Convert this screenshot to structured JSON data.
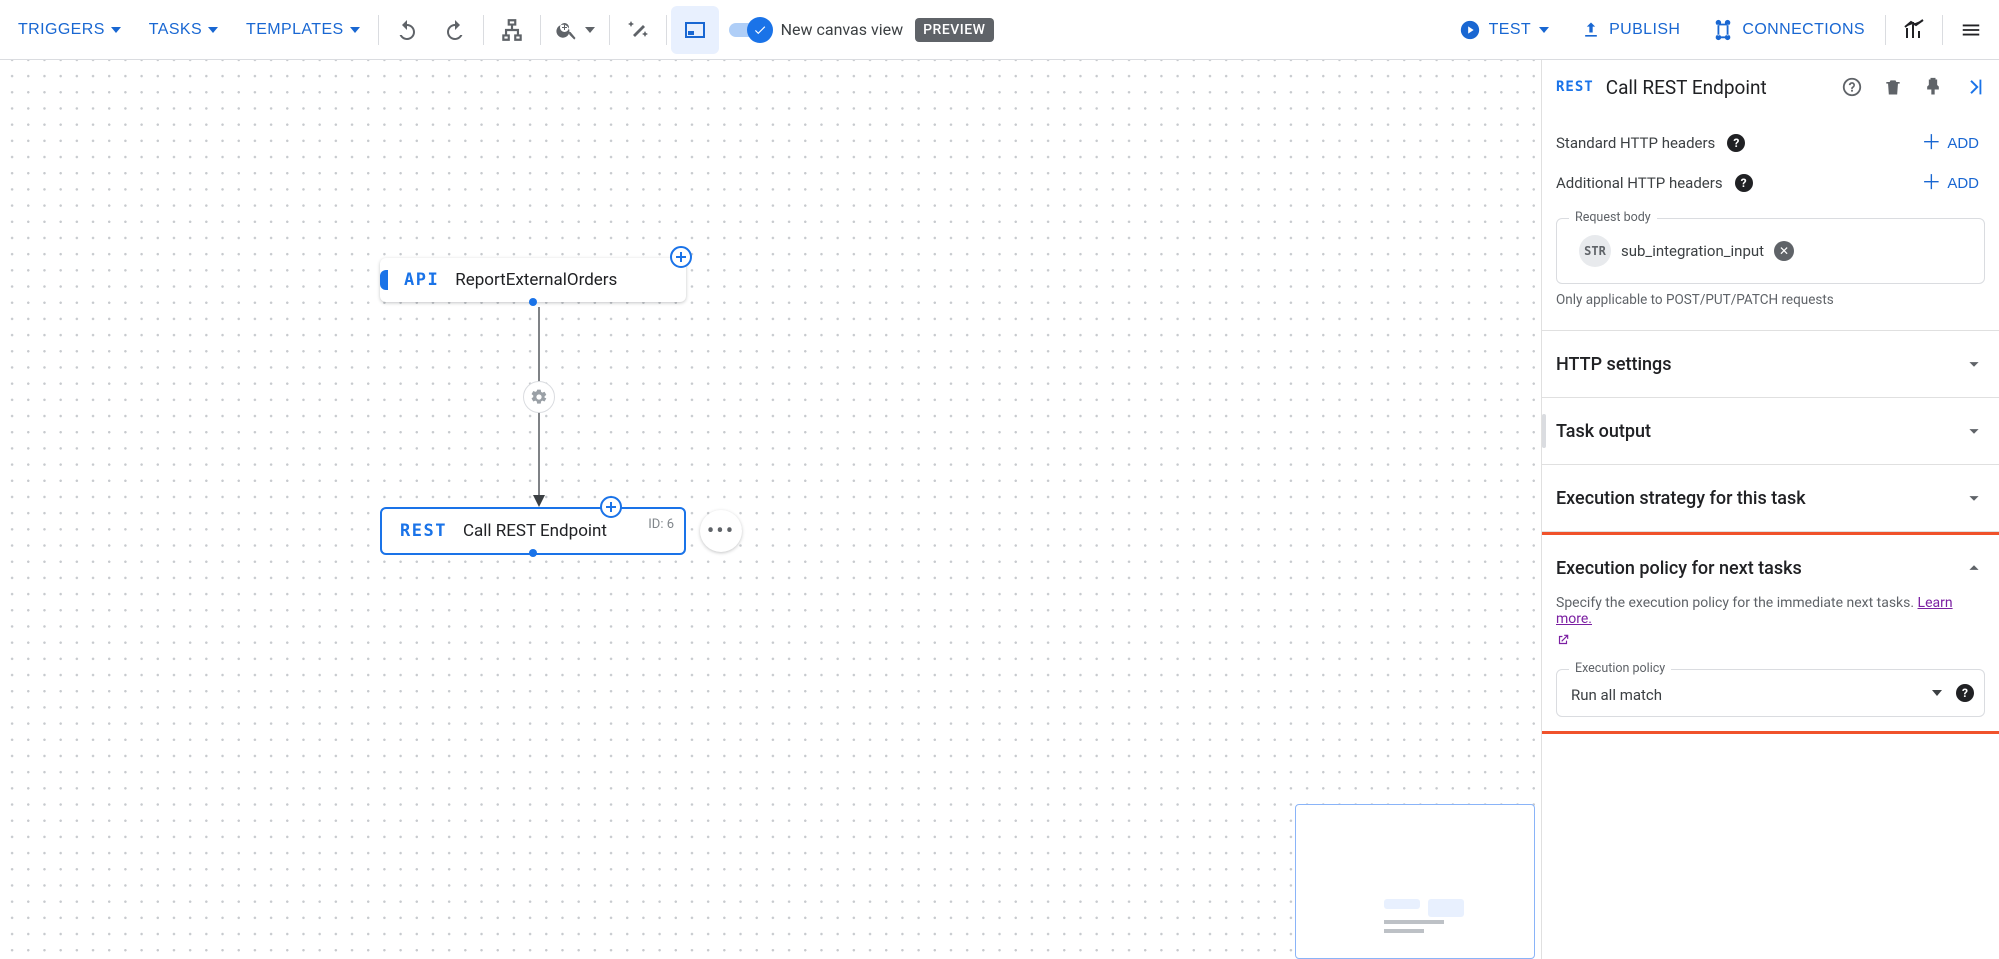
{
  "toolbar": {
    "triggers": "TRIGGERS",
    "tasks": "TASKS",
    "templates": "TEMPLATES",
    "newCanvasLabel": "New canvas view",
    "preview": "PREVIEW",
    "test": "TEST",
    "publish": "PUBLISH",
    "connections": "CONNECTIONS"
  },
  "canvas": {
    "triggerNode": {
      "type": "API",
      "title": "ReportExternalOrders"
    },
    "taskNode": {
      "type": "REST",
      "title": "Call REST Endpoint",
      "id": "ID: 6"
    }
  },
  "panel": {
    "type": "REST",
    "title": "Call REST Endpoint",
    "rows": {
      "stdHeaders": "Standard HTTP headers",
      "addHeaders": "Additional HTTP headers",
      "addBtn": "ADD"
    },
    "requestBody": {
      "legend": "Request body",
      "chipBadge": "STR",
      "chipText": "sub_integration_input",
      "helper": "Only applicable to POST/PUT/PATCH requests"
    },
    "sections": {
      "httpSettings": "HTTP settings",
      "taskOutput": "Task output",
      "execStrategy": "Execution strategy for this task"
    },
    "policy": {
      "title": "Execution policy for next tasks",
      "desc": "Specify the execution policy for the immediate next tasks. ",
      "learn": "Learn more.",
      "selectLegend": "Execution policy",
      "selectValue": "Run all match"
    }
  }
}
